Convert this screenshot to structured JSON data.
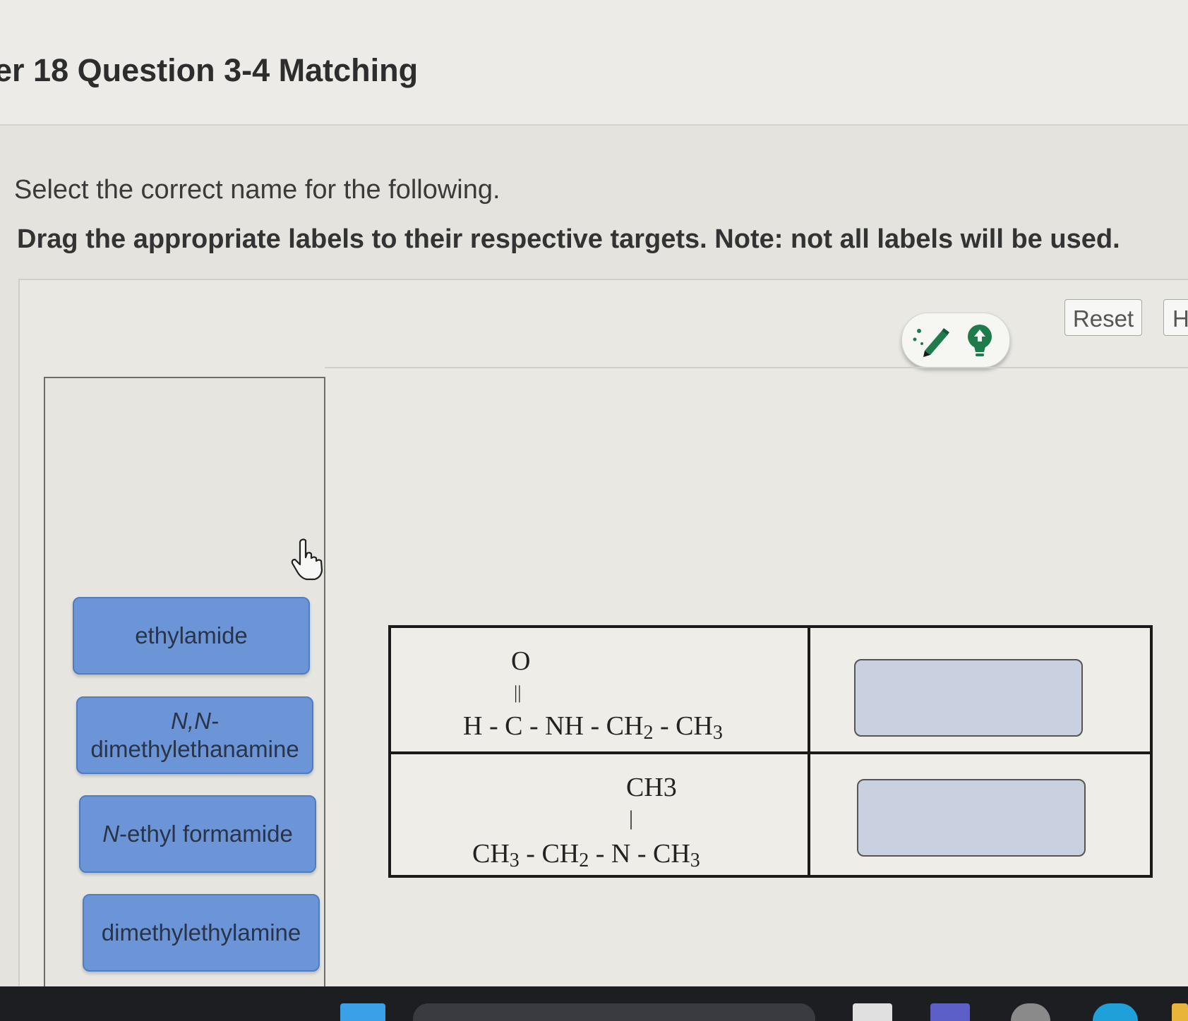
{
  "header": {
    "title": "er 18 Question 3-4 Matching"
  },
  "question": {
    "prompt": "Select the correct name for the following.",
    "instructions": "Drag the appropriate labels to their respective targets. Note: not all labels will be used."
  },
  "toolbar": {
    "reset_label": "Reset",
    "help_label": "H",
    "icons": [
      "pencil-icon",
      "lightbulb-icon"
    ]
  },
  "labels": [
    {
      "text": "ethylamide"
    },
    {
      "prefix": "N,N-",
      "text": "dimethylethanamine"
    },
    {
      "prefix": "N",
      "text": "-ethyl formamide"
    },
    {
      "text": "dimethylethylamine"
    }
  ],
  "structures": [
    {
      "top": "O",
      "bond": "||",
      "main": [
        "H - C - NH - CH",
        "2",
        " - CH",
        "3"
      ]
    },
    {
      "top": "CH3",
      "bond": "|",
      "main": [
        "CH",
        "3",
        " - CH",
        "2",
        " - N - CH",
        "3"
      ]
    }
  ],
  "colors": {
    "label_fill": "#6b95d6",
    "target_fill": "#c9d0df",
    "accent_green": "#1f7a4c"
  }
}
